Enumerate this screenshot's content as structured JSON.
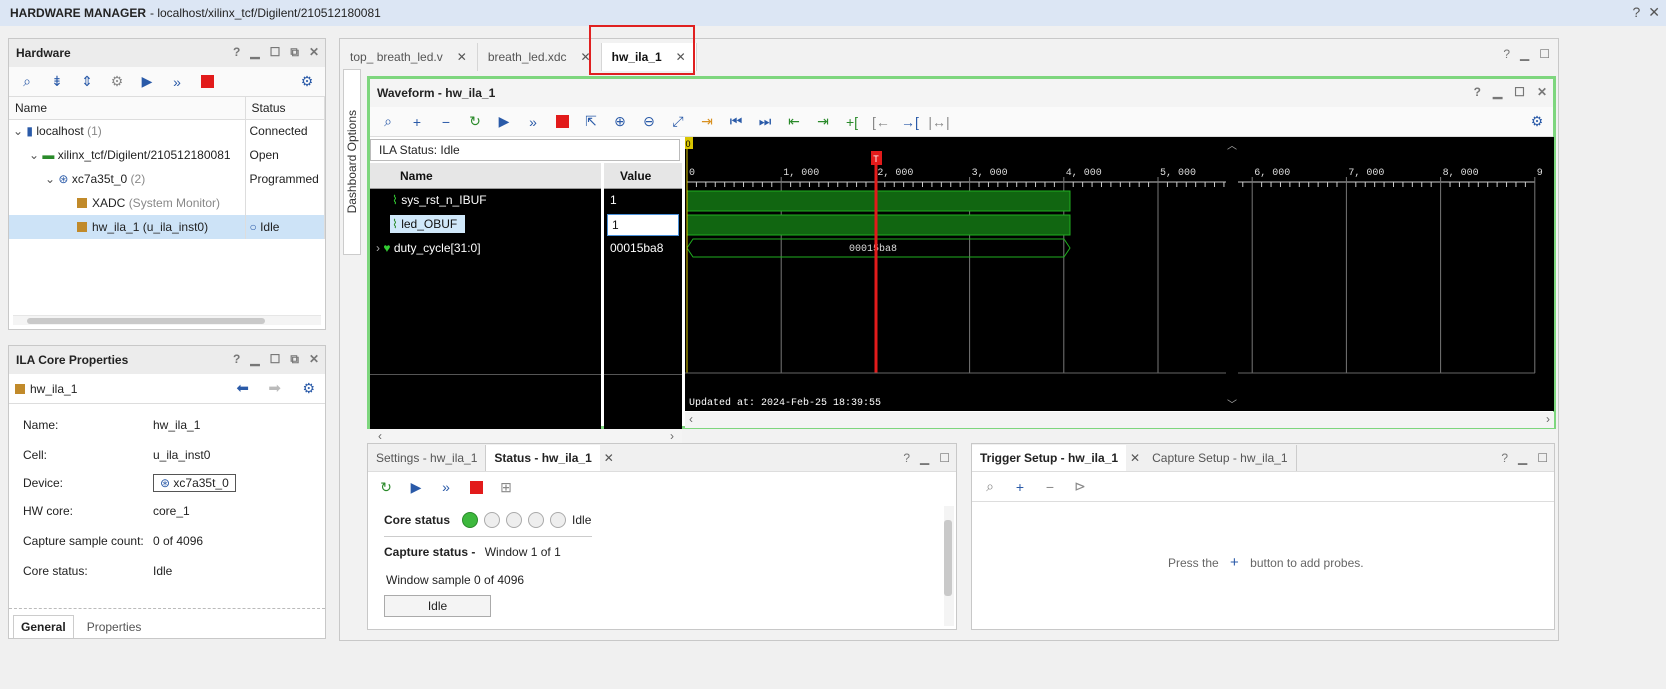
{
  "titlebar": {
    "title": "HARDWARE MANAGER",
    "path": "- localhost/xilinx_tcf/Digilent/210512180081",
    "help": "?",
    "close": "✕"
  },
  "hardware": {
    "title": "Hardware",
    "columns": {
      "name": "Name",
      "status": "Status"
    },
    "rows": [
      {
        "name": "localhost",
        "extra": "(1)",
        "status": "Connected"
      },
      {
        "name": "xilinx_tcf/Digilent/210512180081",
        "extra": "",
        "status": "Open"
      },
      {
        "name": "xc7a35t_0",
        "extra": "(2)",
        "status": "Programmed"
      },
      {
        "name": "XADC",
        "extra": "(System Monitor)",
        "status": ""
      },
      {
        "name": "hw_ila_1",
        "extra": "(u_ila_inst0)",
        "status": "Idle"
      }
    ]
  },
  "ila_props": {
    "title": "ILA Core Properties",
    "core_name": "hw_ila_1",
    "rows": [
      {
        "k": "Name:",
        "v": "hw_ila_1"
      },
      {
        "k": "Cell:",
        "v": "u_ila_inst0"
      },
      {
        "k": "Device:",
        "v": "xc7a35t_0"
      },
      {
        "k": "HW core:",
        "v": "core_1"
      },
      {
        "k": "Capture sample count:",
        "v": "0 of 4096"
      },
      {
        "k": "Core status:",
        "v": "Idle"
      }
    ],
    "tabs": {
      "general": "General",
      "properties": "Properties"
    }
  },
  "editor_tabs": [
    {
      "label": "top_ breath_led.v"
    },
    {
      "label": "breath_led.xdc"
    },
    {
      "label": "hw_ila_1"
    }
  ],
  "side_tab": "Dashboard Options",
  "waveform": {
    "title": "Waveform - hw_ila_1",
    "ila_status": "ILA Status: Idle",
    "name_header": "Name",
    "value_header": "Value",
    "signals": [
      {
        "name": "sys_rst_n_IBUF",
        "value": "1"
      },
      {
        "name": "led_OBUF",
        "value": "1"
      },
      {
        "name": "duty_cycle[31:0]",
        "value": "00015ba8"
      }
    ],
    "bus_label": "00015ba8",
    "ticks": [
      "0",
      "1, 000",
      "2, 000",
      "3, 000",
      "4, 000",
      "5, 000",
      "6, 000",
      "7, 000",
      "8, 000",
      "9"
    ],
    "trigger_marker": "T",
    "zero_marker": "0",
    "updated": "Updated at: 2024-Feb-25 18:39:55"
  },
  "status_panel": {
    "tabs": {
      "settings": "Settings - hw_ila_1",
      "status": "Status - hw_ila_1"
    },
    "core_status_label": "Core status",
    "core_status_value": "Idle",
    "capture_status_label": "Capture status -",
    "capture_status_value": "Window 1 of 1",
    "window_sample": "Window sample 0 of 4096",
    "idle_button": "Idle"
  },
  "trigger_panel": {
    "tabs": {
      "trigger": "Trigger Setup - hw_ila_1",
      "capture": "Capture Setup - hw_ila_1"
    },
    "hint_pre": "Press the",
    "hint_post": "button to add probes."
  },
  "colors": {
    "accent": "#2a5aa8",
    "wave_green": "#1f8a1f",
    "trigger_red": "#e21b1b",
    "highlight_box": "#e02020"
  }
}
